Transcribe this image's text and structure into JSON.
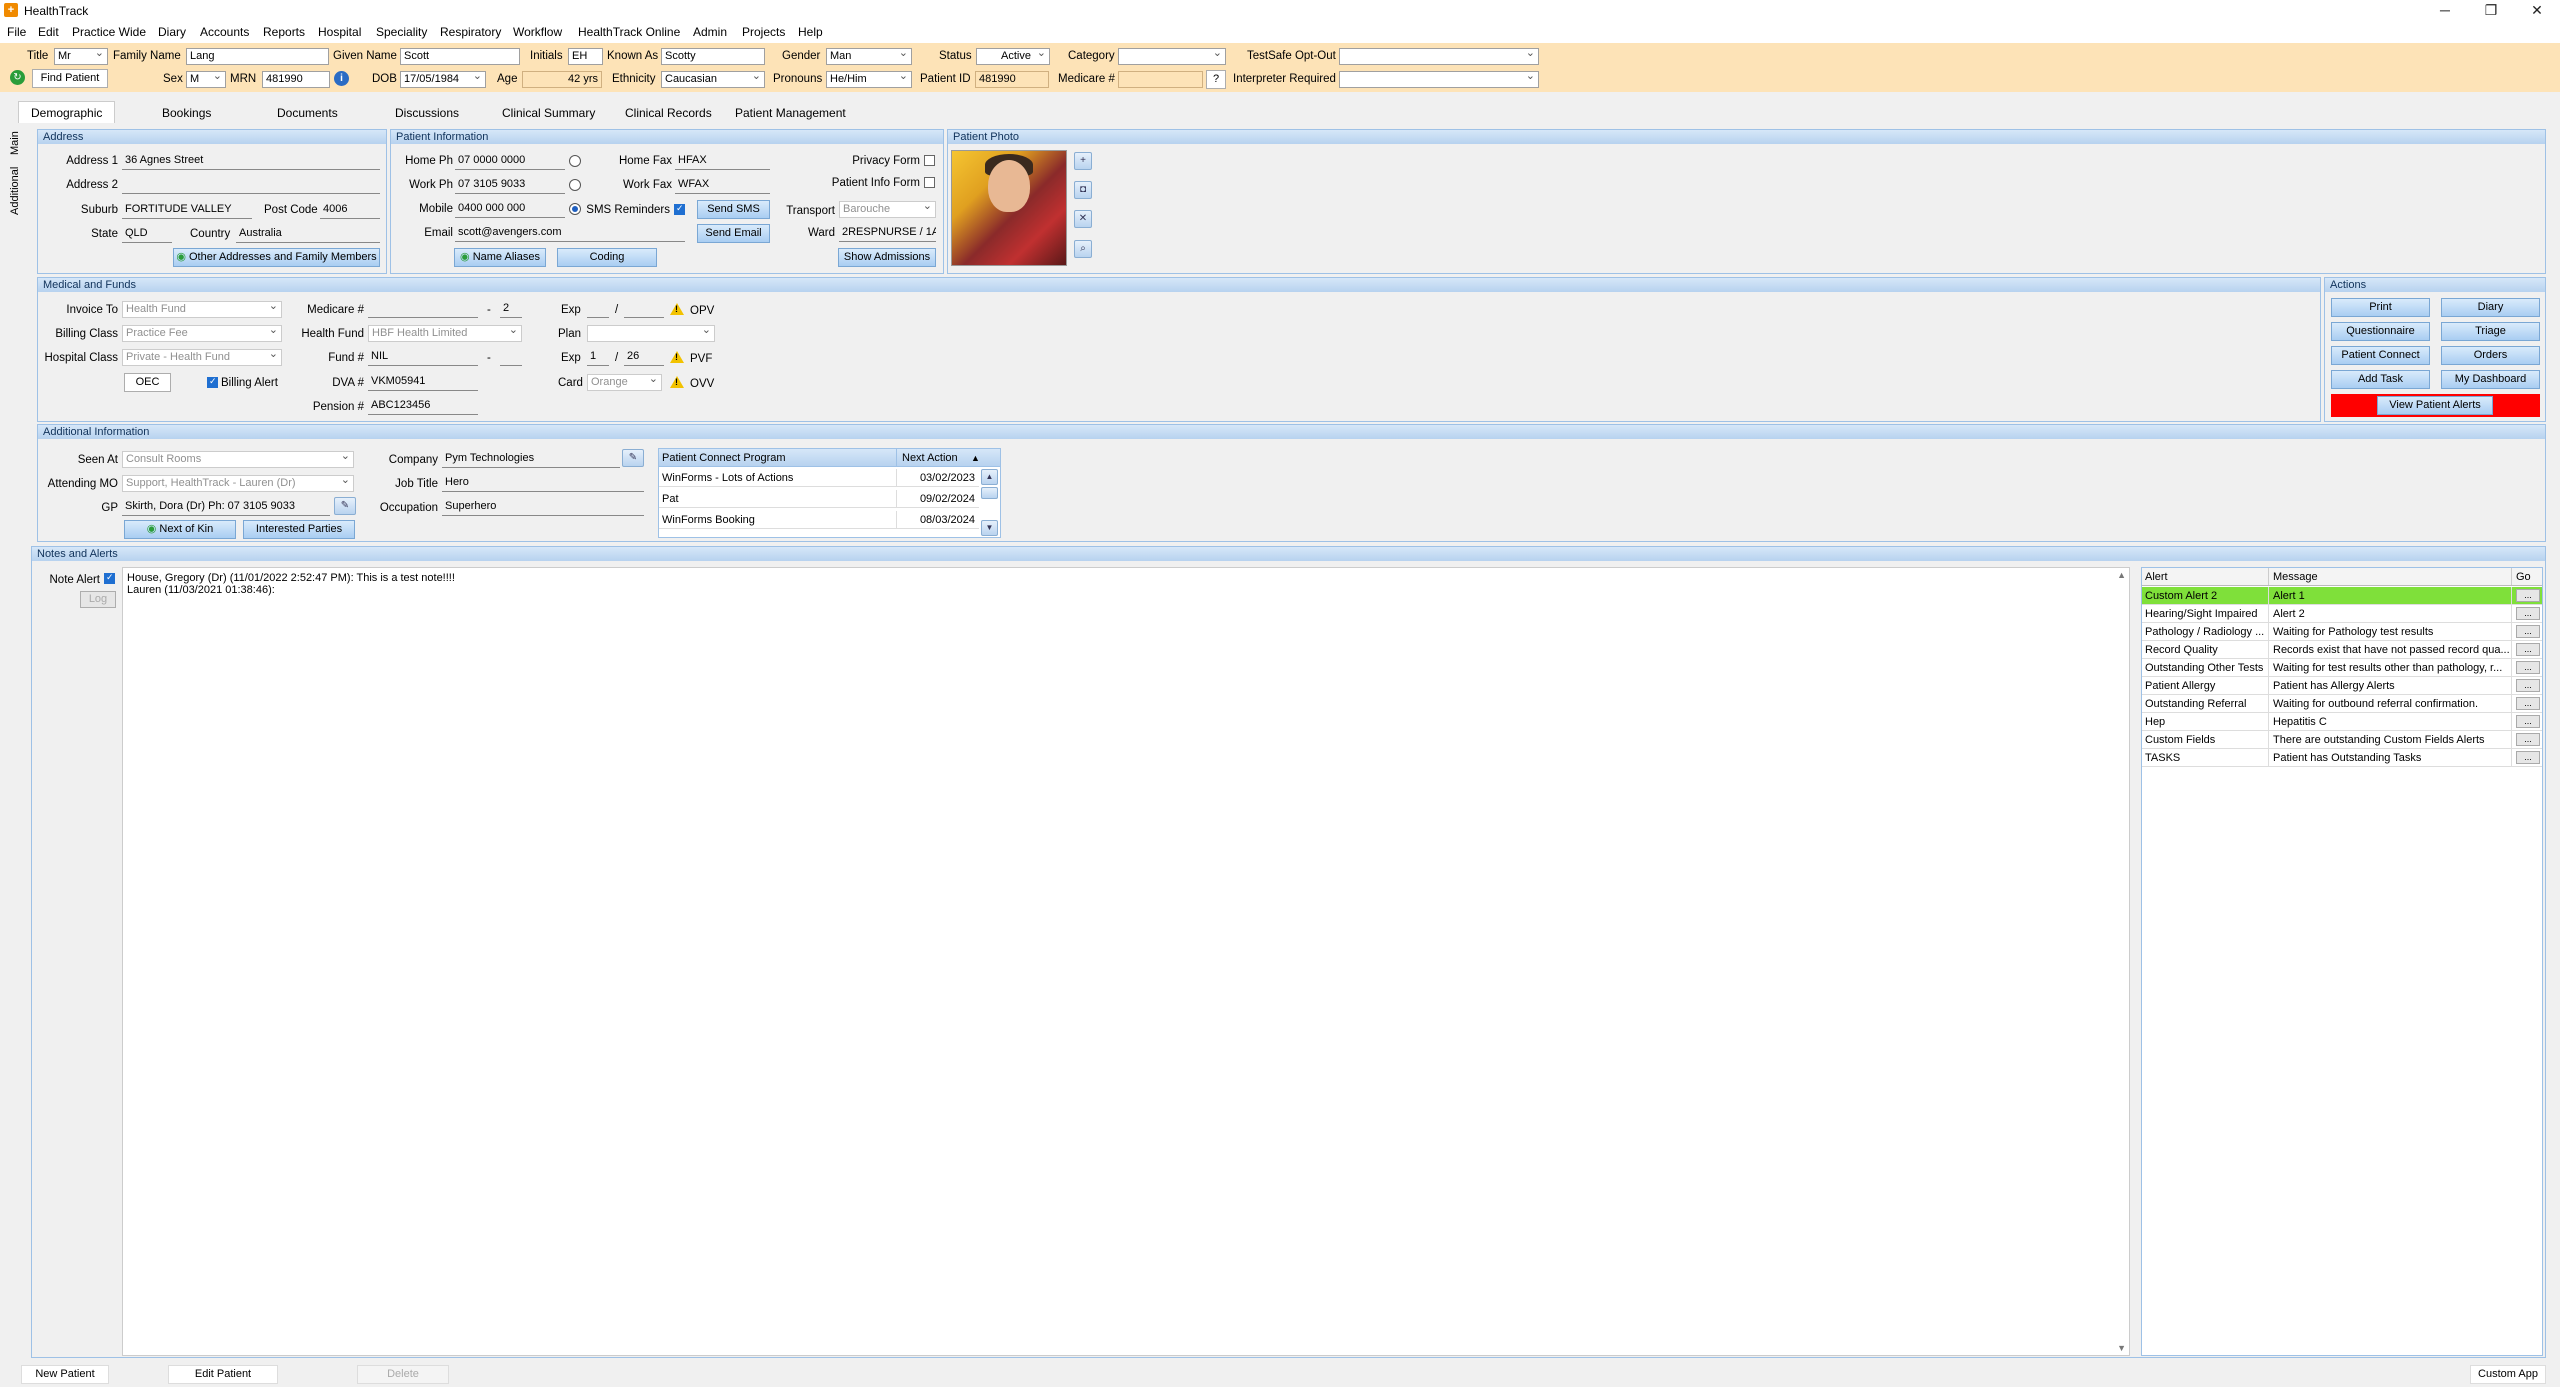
{
  "window": {
    "title": "HealthTrack",
    "minimize": "─",
    "maximize": "❐",
    "close": "✕"
  },
  "menu": [
    "File",
    "Edit",
    "Practice Wide",
    "Diary",
    "Accounts",
    "Reports",
    "Hospital",
    "Speciality",
    "Respiratory",
    "Workflow",
    "HealthTrack Online",
    "Admin",
    "Projects",
    "Help"
  ],
  "header": {
    "title_label": "Title",
    "title": "Mr",
    "family_name_label": "Family Name",
    "family_name": "Lang",
    "given_name_label": "Given Name",
    "given_name": "Scott",
    "initials_label": "Initials",
    "initials": "EH",
    "known_as_label": "Known As",
    "known_as": "Scotty",
    "gender_label": "Gender",
    "gender": "Man",
    "status_label": "Status",
    "status": "Active",
    "category_label": "Category",
    "category": "",
    "testsafe_label": "TestSafe Opt-Out",
    "testsafe": "",
    "find_patient": "Find Patient",
    "sex_label": "Sex",
    "sex": "M",
    "mrn_label": "MRN",
    "mrn": "481990",
    "dob_label": "DOB",
    "dob": "17/05/1984",
    "age_label": "Age",
    "age": "42 yrs",
    "ethnicity_label": "Ethnicity",
    "ethnicity": "Caucasian",
    "pronouns_label": "Pronouns",
    "pronouns": "He/Him",
    "patient_id_label": "Patient ID",
    "patient_id": "481990",
    "medicare_label": "Medicare #",
    "medicare": "",
    "help": "?",
    "interpreter_label": "Interpreter Required",
    "interpreter": ""
  },
  "tabs": [
    "Demographic",
    "Bookings",
    "Documents",
    "Discussions",
    "Clinical Summary",
    "Clinical Records",
    "Patient Management"
  ],
  "side_tabs": {
    "main": "Main",
    "additional": "Additional"
  },
  "address": {
    "header": "Address",
    "address1_label": "Address 1",
    "address1": "36 Agnes Street",
    "address2_label": "Address 2",
    "address2": "",
    "suburb_label": "Suburb",
    "suburb": "FORTITUDE VALLEY",
    "postcode_label": "Post Code",
    "postcode": "4006",
    "state_label": "State",
    "state": "QLD",
    "country_label": "Country",
    "country": "Australia",
    "other_button": "Other Addresses and Family Members"
  },
  "patient_info": {
    "header": "Patient Information",
    "home_ph_label": "Home Ph",
    "home_ph": "07 0000 0000",
    "work_ph_label": "Work Ph",
    "work_ph": "07 3105 9033",
    "mobile_label": "Mobile",
    "mobile": "0400 000 000",
    "email_label": "Email",
    "email": "scott@avengers.com",
    "home_fax_label": "Home Fax",
    "home_fax": "HFAX",
    "work_fax_label": "Work Fax",
    "work_fax": "WFAX",
    "sms_label": "SMS Reminders",
    "send_sms": "Send SMS",
    "send_email": "Send Email",
    "privacy_label": "Privacy Form",
    "patient_info_form_label": "Patient Info Form",
    "transport_label": "Transport",
    "transport": "Barouche",
    "ward_label": "Ward",
    "ward": "2RESPNURSE / 1A",
    "show_admissions": "Show Admissions",
    "name_aliases": "Name Aliases",
    "coding": "Coding"
  },
  "photo": {
    "header": "Patient Photo"
  },
  "medical": {
    "header": "Medical and Funds",
    "invoice_to_label": "Invoice To",
    "invoice_to": "Health Fund",
    "billing_class_label": "Billing Class",
    "billing_class": "Practice Fee",
    "hospital_class_label": "Hospital Class",
    "hospital_class": "Private - Health Fund",
    "oec": "OEC",
    "billing_alert": "Billing Alert",
    "medicare_label": "Medicare #",
    "medicare": "",
    "medicare_dash": "-",
    "medicare_irn": "2",
    "health_fund_label": "Health Fund",
    "health_fund": "HBF Health Limited",
    "fund_label": "Fund #",
    "fund": "NIL",
    "fund_dash": "-",
    "dva_label": "DVA #",
    "dva": "VKM05941",
    "pension_label": "Pension #",
    "pension": "ABC123456",
    "exp_label": "Exp",
    "exp1_a": "",
    "exp1_b": "",
    "slash": "/",
    "plan_label": "Plan",
    "plan": "",
    "exp2_a": "1",
    "exp2_b": "26",
    "card_label": "Card",
    "card": "Orange",
    "opv": "OPV",
    "pvf": "PVF",
    "ovv": "OVV"
  },
  "actions": {
    "header": "Actions",
    "print": "Print",
    "diary": "Diary",
    "questionnaire": "Questionnaire",
    "triage": "Triage",
    "patient_connect": "Patient Connect",
    "orders": "Orders",
    "add_task": "Add Task",
    "my_dashboard": "My Dashboard",
    "view_alerts": "View Patient Alerts",
    "alert_color": "#ff0000"
  },
  "additional": {
    "header": "Additional Information",
    "seen_at_label": "Seen At",
    "seen_at": "Consult Rooms",
    "attending_label": "Attending MO",
    "attending": "Support, HealthTrack - Lauren (Dr)",
    "gp_label": "GP",
    "gp": "Skirth, Dora (Dr) Ph: 07 3105 9033",
    "next_of_kin": "Next of Kin",
    "interested": "Interested Parties",
    "company_label": "Company",
    "company": "Pym Technologies",
    "job_label": "Job Title",
    "job": "Hero",
    "occupation_label": "Occupation",
    "occupation": "Superhero"
  },
  "pc_grid": {
    "col1": "Patient Connect Program",
    "col2": "Next Action",
    "rows": [
      {
        "program": "WinForms - Lots of Actions",
        "next": "03/02/2023"
      },
      {
        "program": "Pat",
        "next": "09/02/2024"
      },
      {
        "program": "WinForms Booking",
        "next": "08/03/2024"
      }
    ]
  },
  "notes": {
    "header": "Notes and Alerts",
    "note_alert_label": "Note Alert",
    "log": "Log",
    "lines": [
      "House, Gregory (Dr) (11/01/2022 2:52:47 PM): This is a test note!!!!",
      "Lauren (11/03/2021 01:38:46):"
    ]
  },
  "alerts_grid": {
    "col_alert": "Alert",
    "col_message": "Message",
    "col_go": "Go",
    "go": "...",
    "highlight": "#7fe03a",
    "rows": [
      {
        "alert": "Custom Alert 2",
        "message": "Alert 1"
      },
      {
        "alert": "Hearing/Sight Impaired",
        "message": "Alert 2"
      },
      {
        "alert": "Pathology / Radiology ...",
        "message": "Waiting for Pathology test results"
      },
      {
        "alert": "Record Quality",
        "message": "Records exist that have not passed record qua..."
      },
      {
        "alert": "Outstanding Other Tests",
        "message": "Waiting for test results other than pathology, r..."
      },
      {
        "alert": "Patient Allergy",
        "message": "Patient has Allergy Alerts"
      },
      {
        "alert": "Outstanding Referral",
        "message": "Waiting for outbound referral confirmation."
      },
      {
        "alert": "Hep",
        "message": "Hepatitis C"
      },
      {
        "alert": "Custom Fields",
        "message": "There are outstanding Custom Fields Alerts"
      },
      {
        "alert": "TASKS",
        "message": "Patient has Outstanding Tasks"
      }
    ]
  },
  "footer": {
    "new_patient": "New Patient",
    "edit_patient": "Edit Patient",
    "delete": "Delete",
    "custom_app": "Custom App"
  }
}
